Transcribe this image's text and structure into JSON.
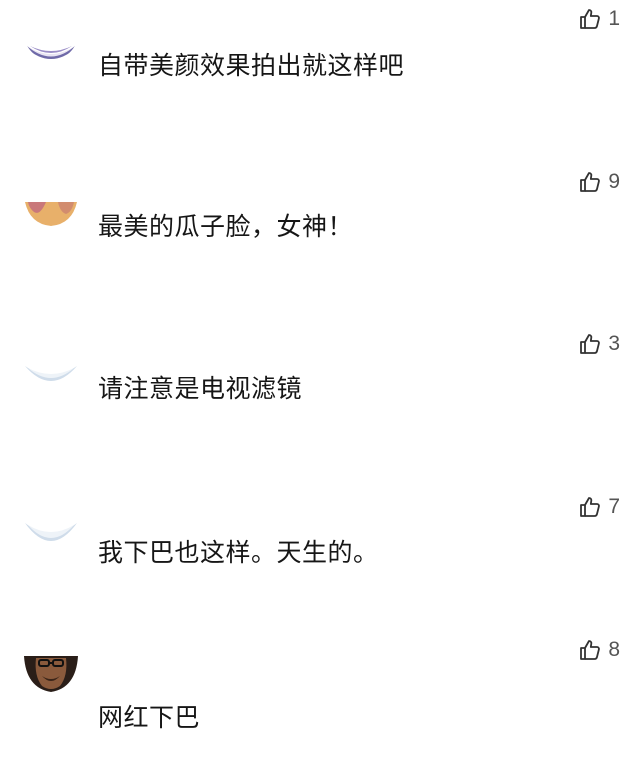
{
  "comments": [
    {
      "text": "自带美颜效果拍出就这样吧",
      "likes": "1",
      "avatar_color": "#6f6aa8"
    },
    {
      "text": "最美的瓜子脸，女神！",
      "likes": "9",
      "avatar_color": "#e0a55a"
    },
    {
      "text": "请注意是电视滤镜",
      "likes": "3",
      "avatar_color": "#d6e2ee"
    },
    {
      "text": "我下巴也这样。天生的。",
      "likes": "7",
      "avatar_color": "#d6e2ee"
    },
    {
      "text": "网红下巴",
      "likes": "8",
      "avatar_color": "#3a2a22"
    }
  ],
  "icons": {
    "like": "thumbs-up-icon"
  }
}
